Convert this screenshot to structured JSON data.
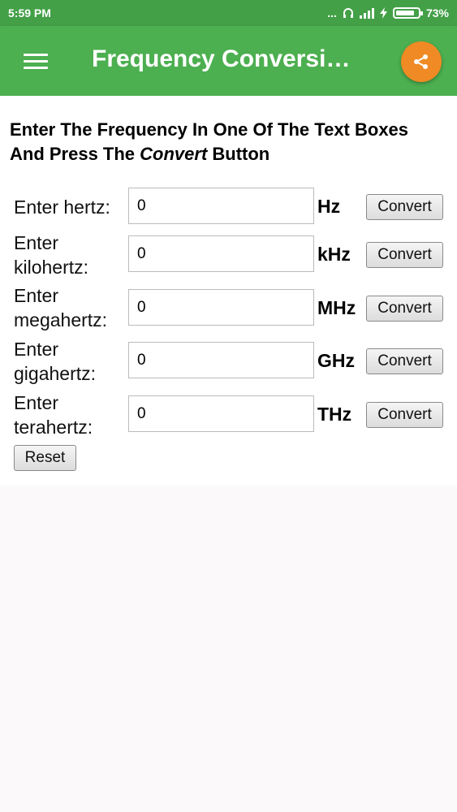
{
  "status": {
    "time": "5:59 PM",
    "dots": "...",
    "battery": "73%"
  },
  "appbar": {
    "title": "Frequency Conversion...",
    "menu_icon": "hamburger-menu-icon",
    "share_icon": "share-icon"
  },
  "instructions": {
    "line1": "Enter The Frequency In One Of The Text Boxes",
    "line2_start": "And Press The ",
    "line2_em": "Convert",
    "line2_end": " Button"
  },
  "rows": [
    {
      "label": "Enter hertz:",
      "value": "0",
      "unit": "Hz",
      "button": "Convert"
    },
    {
      "label": "Enter kilohertz:",
      "value": "0",
      "unit": "kHz",
      "button": "Convert"
    },
    {
      "label": "Enter megahertz:",
      "value": "0",
      "unit": "MHz",
      "button": "Convert"
    },
    {
      "label": "Enter gigahertz:",
      "value": "0",
      "unit": "GHz",
      "button": "Convert"
    },
    {
      "label": "Enter terahertz:",
      "value": "0",
      "unit": "THz",
      "button": "Convert"
    }
  ],
  "reset_label": "Reset",
  "colors": {
    "status_bar": "#43a047",
    "app_bar": "#4caf50",
    "share_button": "#f08a24"
  }
}
